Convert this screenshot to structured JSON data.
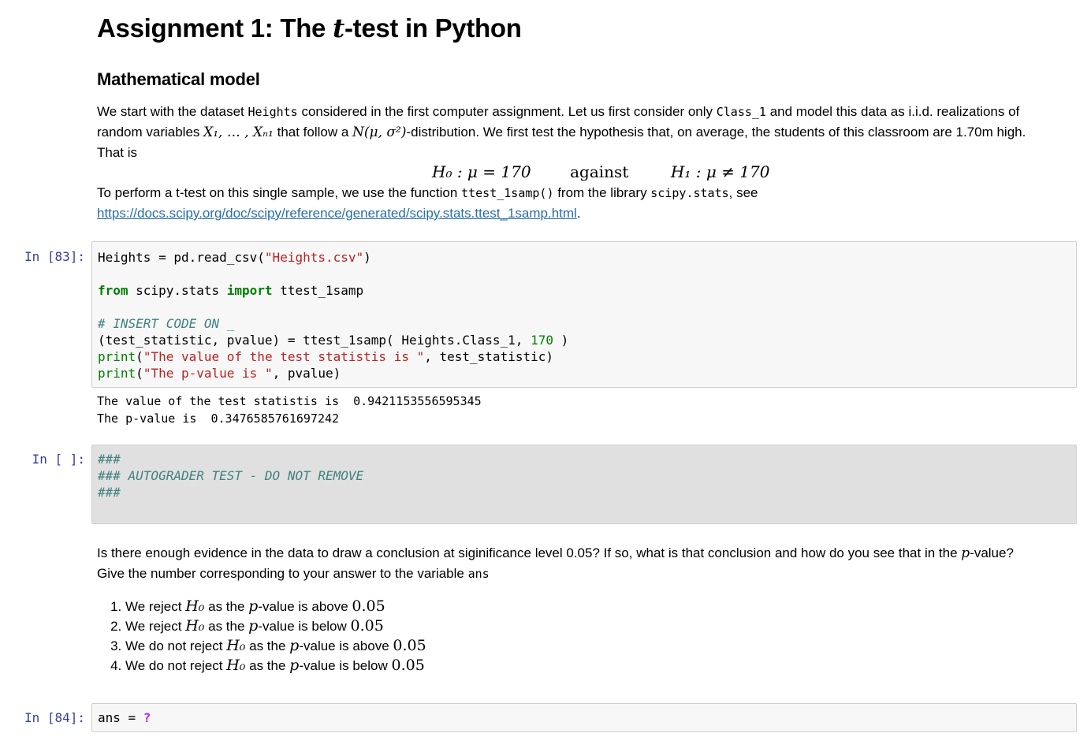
{
  "title": {
    "prefix": "Assignment 1: The ",
    "t": "t",
    "suffix": "-test in Python"
  },
  "section_heading": "Mathematical model",
  "intro": {
    "p1_a": "We start with the dataset ",
    "p1_code1": "Heights",
    "p1_b": " considered in the first computer assignment. Let us first consider only ",
    "p1_code2": "Class_1",
    "p1_c": " and model this data as i.i.d. realizations of",
    "p2_a": "random variables ",
    "p2_math1": "X₁, … , Xₙ₁",
    "p2_b": " that follow a ",
    "p2_math2": "N(μ, σ²)",
    "p2_c": "-distribution. We first test the hypothesis that, on average, the students of this classroom are 1.70m high.",
    "p3": "That is"
  },
  "hypothesis": {
    "h0": "H₀ : μ = 170",
    "against": "against",
    "h1": "H₁ : μ ≠ 170"
  },
  "perform": {
    "a": "To perform a t-test on this single sample, we use the function ",
    "code1": "ttest_1samp()",
    "b": " from the library ",
    "code2": "scipy.stats",
    "c": ", see",
    "link": "https://docs.scipy.org/doc/scipy/reference/generated/scipy.stats.ttest_1samp.html",
    "link_end": "."
  },
  "cell83": {
    "prompt": "In [83]:",
    "output_line1": "The value of the test statistis is  0.9421153556595345",
    "output_line2": "The p-value is  0.3476585761697242"
  },
  "cell_autograder": {
    "prompt": "In [ ]:"
  },
  "question": {
    "line1_a": "Is there enough evidence in the data to draw a conclusion at siginificance level 0.05? If so, what is that conclusion and how do you see that in the ",
    "line1_p": "p",
    "line1_b": "-value?",
    "line2_a": "Give the number corresponding to your answer to the variable ",
    "line2_code": "ans"
  },
  "options": [
    {
      "a": "We reject ",
      "h": "H₀",
      "b": " as the ",
      "p": "p",
      "c": "-value is above ",
      "v": "0.05"
    },
    {
      "a": "We reject ",
      "h": "H₀",
      "b": " as the ",
      "p": "p",
      "c": "-value is below ",
      "v": "0.05"
    },
    {
      "a": "We do not reject ",
      "h": "H₀",
      "b": " as the ",
      "p": "p",
      "c": "-value is above ",
      "v": "0.05"
    },
    {
      "a": "We do not reject ",
      "h": "H₀",
      "b": " as the ",
      "p": "p",
      "c": "-value is below ",
      "v": "0.05"
    }
  ],
  "cell84": {
    "prompt": "In [84]:"
  },
  "colors": {
    "prompt": "#303f9f",
    "keyword": "#008000",
    "string": "#ba2121",
    "comment": "#408080",
    "link": "#296eaa",
    "cell_bg": "#f7f7f7",
    "readonly_cell_bg": "#e0e0e0"
  }
}
